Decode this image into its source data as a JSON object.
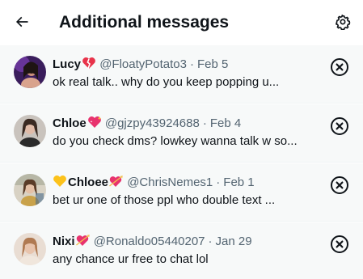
{
  "header": {
    "title": "Additional messages",
    "back_icon": "arrow-left-icon",
    "settings_icon": "gear-icon"
  },
  "messages": [
    {
      "name": "Lucy",
      "emoji": "broken-heart-emoji",
      "handle": "@FloatyPotato3",
      "separator": "·",
      "date": "Feb 5",
      "preview": "ok real talk.. why do you keep popping u..."
    },
    {
      "name": "Chloe",
      "emoji": "sparkling-heart-emoji",
      "handle": "@gjzpy43924688",
      "separator": "·",
      "date": "Feb 4",
      "preview": "do you check dms? lowkey wanna talk w so..."
    },
    {
      "name": "Chloee",
      "emoji_lead": "yellow-heart-emoji",
      "emoji": "heart-with-arrow-emoji",
      "handle": "@ChrisNemes1",
      "separator": "·",
      "date": "Feb 1",
      "preview": "bet ur one of those ppl who double text ..."
    },
    {
      "name": "Nixi",
      "emoji": "heart-with-arrow-emoji",
      "handle": "@Ronaldo05440207",
      "separator": "·",
      "date": "Jan 29",
      "preview": "any chance ur free to chat lol"
    }
  ],
  "colors": {
    "text_primary": "#0f1419",
    "text_secondary": "#536471",
    "row_background": "#f7f9f9",
    "divider": "#eff3f4"
  }
}
